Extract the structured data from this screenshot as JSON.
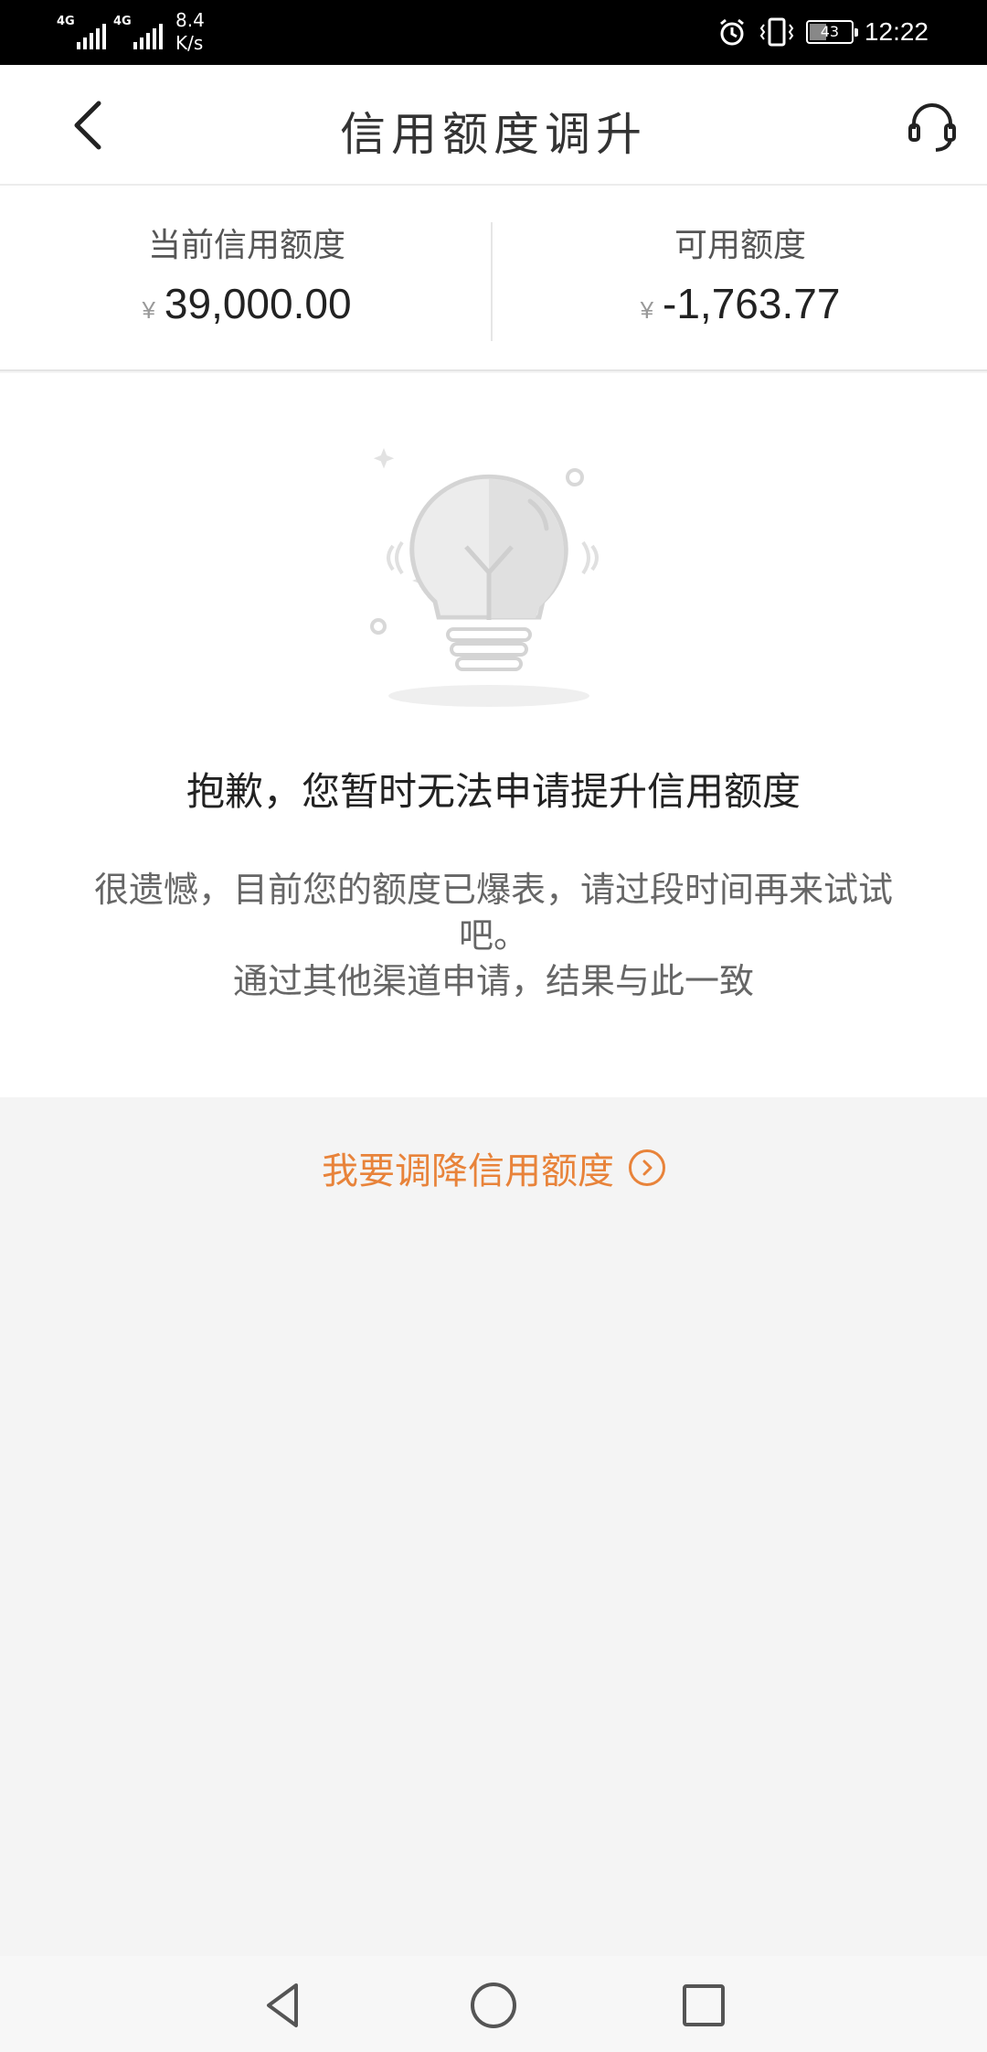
{
  "status_bar": {
    "network_1": "4G",
    "network_2": "4G",
    "speed_value": "8.4",
    "speed_unit": "K/s",
    "battery": "43",
    "time": "12:22"
  },
  "header": {
    "title": "信用额度调升",
    "back_icon": "chevron-left-icon",
    "support_icon": "headset-icon"
  },
  "summary": {
    "current_label": "当前信用额度",
    "current_currency": "¥",
    "current_amount": "39,000.00",
    "available_label": "可用额度",
    "available_currency": "¥",
    "available_amount": "-1,763.77"
  },
  "main": {
    "illustration_icon": "lightbulb-icon",
    "headline": "抱歉，您暂时无法申请提升信用额度",
    "desc_line1": "很遗憾，目前您的额度已爆表，请过段时间再来试试吧。",
    "desc_line2": "通过其他渠道申请，结果与此一致"
  },
  "lower_action": {
    "label": "我要调降信用额度",
    "icon": "chevron-right-circle-icon",
    "accent_color": "#e8833a"
  },
  "nav_bar": {
    "back_icon": "triangle-back-icon",
    "home_icon": "circle-home-icon",
    "recents_icon": "square-recents-icon"
  }
}
